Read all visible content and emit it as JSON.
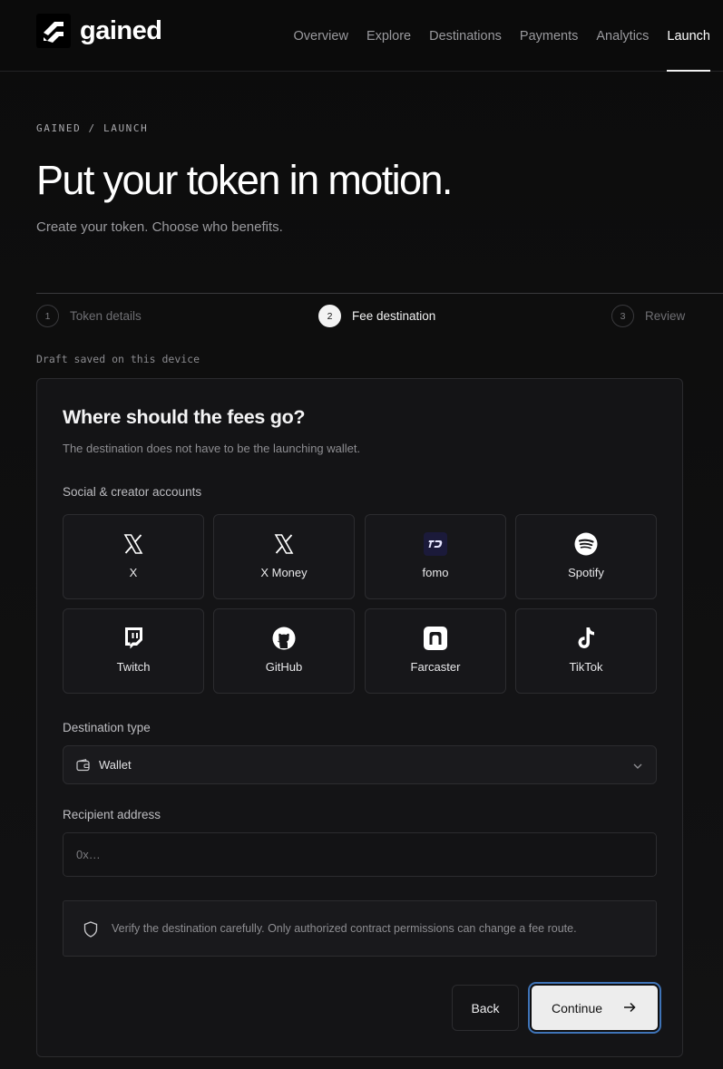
{
  "brand": {
    "name": "gained",
    "logo_icon": "gained-logo-icon"
  },
  "nav": {
    "links": [
      {
        "label": "Overview"
      },
      {
        "label": "Explore"
      },
      {
        "label": "Destinations"
      },
      {
        "label": "Payments"
      },
      {
        "label": "Analytics"
      },
      {
        "label": "Launch",
        "active": true
      }
    ]
  },
  "header": {
    "breadcrumb": "GAINED / LAUNCH",
    "title": "Put your token in motion.",
    "subtitle": "Create your token. Choose who benefits."
  },
  "stepper": {
    "steps": [
      {
        "num": "1",
        "label": "Token details"
      },
      {
        "num": "2",
        "label": "Fee destination",
        "active": true
      },
      {
        "num": "3",
        "label": "Review"
      }
    ]
  },
  "draft_note": "Draft saved on this device",
  "card": {
    "title": "Where should the fees go?",
    "description": "The destination does not have to be the launching wallet.",
    "social_label": "Social & creator accounts",
    "accounts": [
      {
        "label": "X",
        "icon": "x-icon"
      },
      {
        "label": "X Money",
        "icon": "x-money-icon"
      },
      {
        "label": "fomo",
        "icon": "fomo-icon"
      },
      {
        "label": "Spotify",
        "icon": "spotify-icon"
      },
      {
        "label": "Twitch",
        "icon": "twitch-icon"
      },
      {
        "label": "GitHub",
        "icon": "github-icon"
      },
      {
        "label": "Farcaster",
        "icon": "farcaster-icon"
      },
      {
        "label": "TikTok",
        "icon": "tiktok-icon"
      }
    ],
    "destination_type_label": "Destination type",
    "destination_type_value": "Wallet",
    "recipient_label": "Recipient address",
    "recipient_placeholder": "0x…",
    "recipient_value": "",
    "notice": "Verify the destination carefully. Only authorized contract permissions can change a fee route.",
    "back_label": "Back",
    "continue_label": "Continue"
  },
  "colors": {
    "background": "#0f0f10",
    "accent_focus": "#3f74b8",
    "primary_button": "#ededed"
  }
}
